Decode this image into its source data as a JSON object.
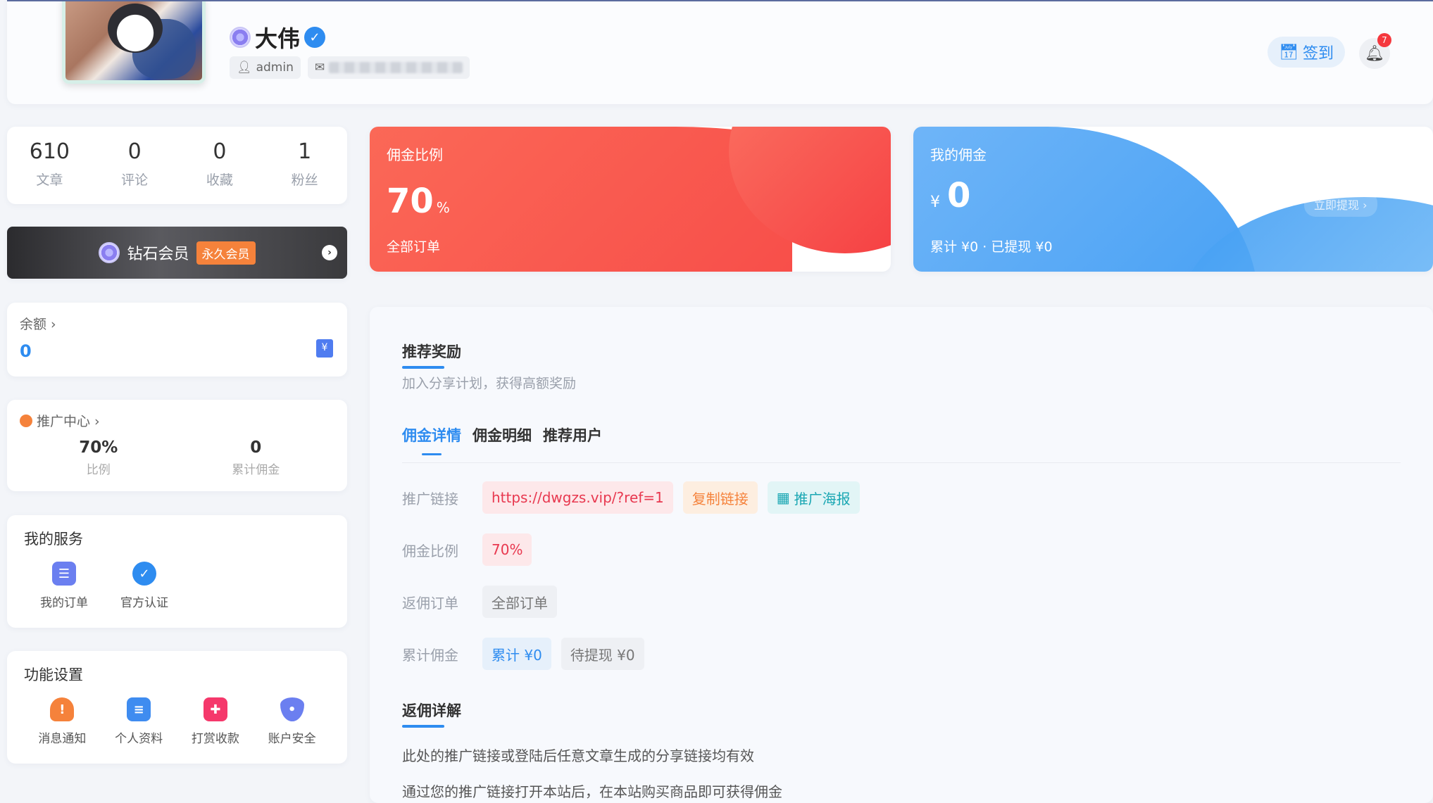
{
  "header": {
    "name": "大伟",
    "username": "admin",
    "checkin_label": "签到",
    "notifications": "7"
  },
  "stats": [
    {
      "value": "610",
      "label": "文章"
    },
    {
      "value": "0",
      "label": "评论"
    },
    {
      "value": "0",
      "label": "收藏"
    },
    {
      "value": "1",
      "label": "粉丝"
    }
  ],
  "vip": {
    "title": "钻石会员",
    "tag": "永久会员"
  },
  "balance": {
    "label": "余额 ›",
    "value": "0",
    "icon": "¥"
  },
  "promo": {
    "label": "推广中心 ›",
    "rate_value": "70%",
    "rate_label": "比例",
    "total_value": "0",
    "total_label": "累计佣金"
  },
  "services": {
    "title": "我的服务",
    "items": [
      {
        "label": "我的订单",
        "icon": "order-icon",
        "color": "#6b7ff0"
      },
      {
        "label": "官方认证",
        "icon": "verified-icon",
        "color": "#2e8cf0"
      }
    ]
  },
  "settings": {
    "title": "功能设置",
    "items": [
      {
        "label": "消息通知",
        "icon": "bell-icon",
        "color": "#f5823b"
      },
      {
        "label": "个人资料",
        "icon": "profile-icon",
        "color": "#3f8cf0"
      },
      {
        "label": "打赏收款",
        "icon": "gift-icon",
        "color": "#f5386b"
      },
      {
        "label": "账户安全",
        "icon": "shield-icon",
        "color": "#6b7ff0"
      }
    ]
  },
  "rate_card": {
    "title": "佣金比例",
    "value": "70",
    "unit": "%",
    "footer": "全部订单"
  },
  "commission_card": {
    "title": "我的佣金",
    "currency": "¥",
    "value": "0",
    "footer": "累计 ¥0 · 已提现 ¥0",
    "withdraw": "立即提现 ›"
  },
  "main": {
    "title": "推荐奖励",
    "subtitle": "加入分享计划，获得高额奖励",
    "tabs": [
      "佣金详情",
      "佣金明细",
      "推荐用户"
    ],
    "rows": {
      "link_key": "推广链接",
      "link_value": "https://dwgzs.vip/?ref=1",
      "copy_label": "复制链接",
      "poster_label": "推广海报",
      "rate_key": "佣金比例",
      "rate_value": "70%",
      "orders_key": "返佣订单",
      "orders_value": "全部订单",
      "total_key": "累计佣金",
      "total_value": "累计 ¥0",
      "pending_value": "待提现 ¥0"
    },
    "detail_title": "返佣详解",
    "detail_lines": [
      "此处的推广链接或登陆后任意文章生成的分享链接均有效",
      "通过您的推广链接打开本站后，在本站购买商品即可获得佣金"
    ]
  }
}
